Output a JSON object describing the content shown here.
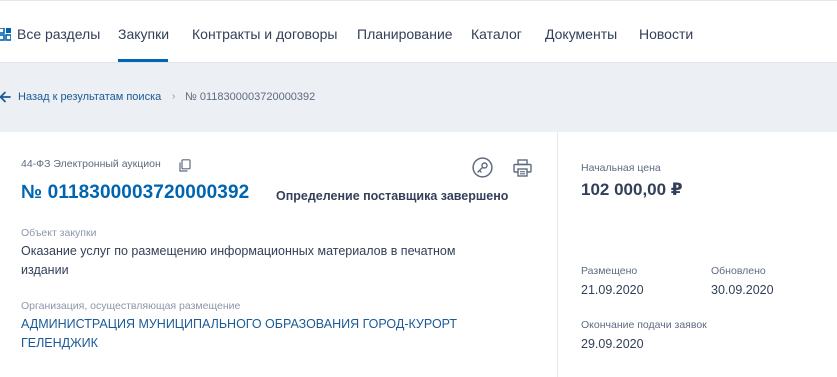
{
  "nav": {
    "items": [
      {
        "label": "Все разделы",
        "active": false
      },
      {
        "label": "Закупки",
        "active": true
      },
      {
        "label": "Контракты и договоры",
        "active": false
      },
      {
        "label": "Планирование",
        "active": false
      },
      {
        "label": "Каталог",
        "active": false
      },
      {
        "label": "Документы",
        "active": false
      },
      {
        "label": "Новости",
        "active": false
      }
    ]
  },
  "breadcrumb": {
    "back_label": "Назад к результатам поиска",
    "separator": "›",
    "current": "№ 0118300003720000392"
  },
  "purchase": {
    "law_type": "44-ФЗ Электронный аукцион",
    "number": "№ 0118300003720000392",
    "status": "Определение поставщика завершено",
    "object_label": "Объект закупки",
    "object_value": "Оказание услуг по размещению информационных материалов в печатном издании",
    "org_label": "Организация, осуществляющая размещение",
    "org_value": "АДМИНИСТРАЦИЯ МУНИЦИПАЛЬНОГО ОБРАЗОВАНИЯ ГОРОД-КУРОРТ ГЕЛЕНДЖИК"
  },
  "side": {
    "price_label": "Начальная цена",
    "price_value": "102 000,00 ₽",
    "posted_label": "Размещено",
    "posted_value": "21.09.2020",
    "updated_label": "Обновлено",
    "updated_value": "30.09.2020",
    "deadline_label": "Окончание подачи заявок",
    "deadline_value": "29.09.2020"
  },
  "colors": {
    "accent": "#0065b1",
    "link": "#1a5a96",
    "text": "#334059",
    "muted": "#8c96a8",
    "band": "#eceff3"
  }
}
